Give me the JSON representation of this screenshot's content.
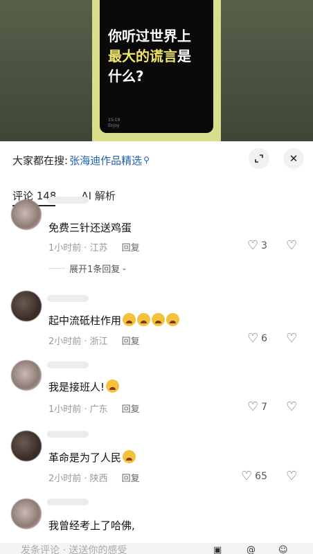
{
  "video": {
    "line1": "你听过世界上",
    "line2_highlight": "最大的谎言",
    "line2_rest": "是",
    "line3": "什么?",
    "small_text": "15:19\nEnjoy"
  },
  "search": {
    "prefix": "大家都在搜:",
    "keyword": "张海迪作品精选"
  },
  "tabs": [
    {
      "label": "评论 148"
    },
    {
      "label": "AI 解析"
    }
  ],
  "comments": [
    {
      "text": "免费三针还送鸡蛋",
      "time": "1小时前 · 江苏",
      "reply": "回复",
      "likes": "3",
      "expand": "展开1条回复"
    },
    {
      "text": "起中流砥柱作用",
      "time": "2小时前 · 浙江",
      "reply": "回复",
      "likes": "6"
    },
    {
      "text": "我是接班人!",
      "time": "1小时前 · 广东",
      "reply": "回复",
      "likes": "7"
    },
    {
      "text": "革命是为了人民",
      "time": "2小时前 · 陕西",
      "reply": "回复",
      "likes": "65"
    },
    {
      "text": "我曾经考上了哈佛,"
    }
  ],
  "input": {
    "placeholder": "发条评论 · 送送你的感受"
  },
  "colors": {
    "keyword": "#1e5fa8",
    "highlight": "#f2e46a"
  }
}
